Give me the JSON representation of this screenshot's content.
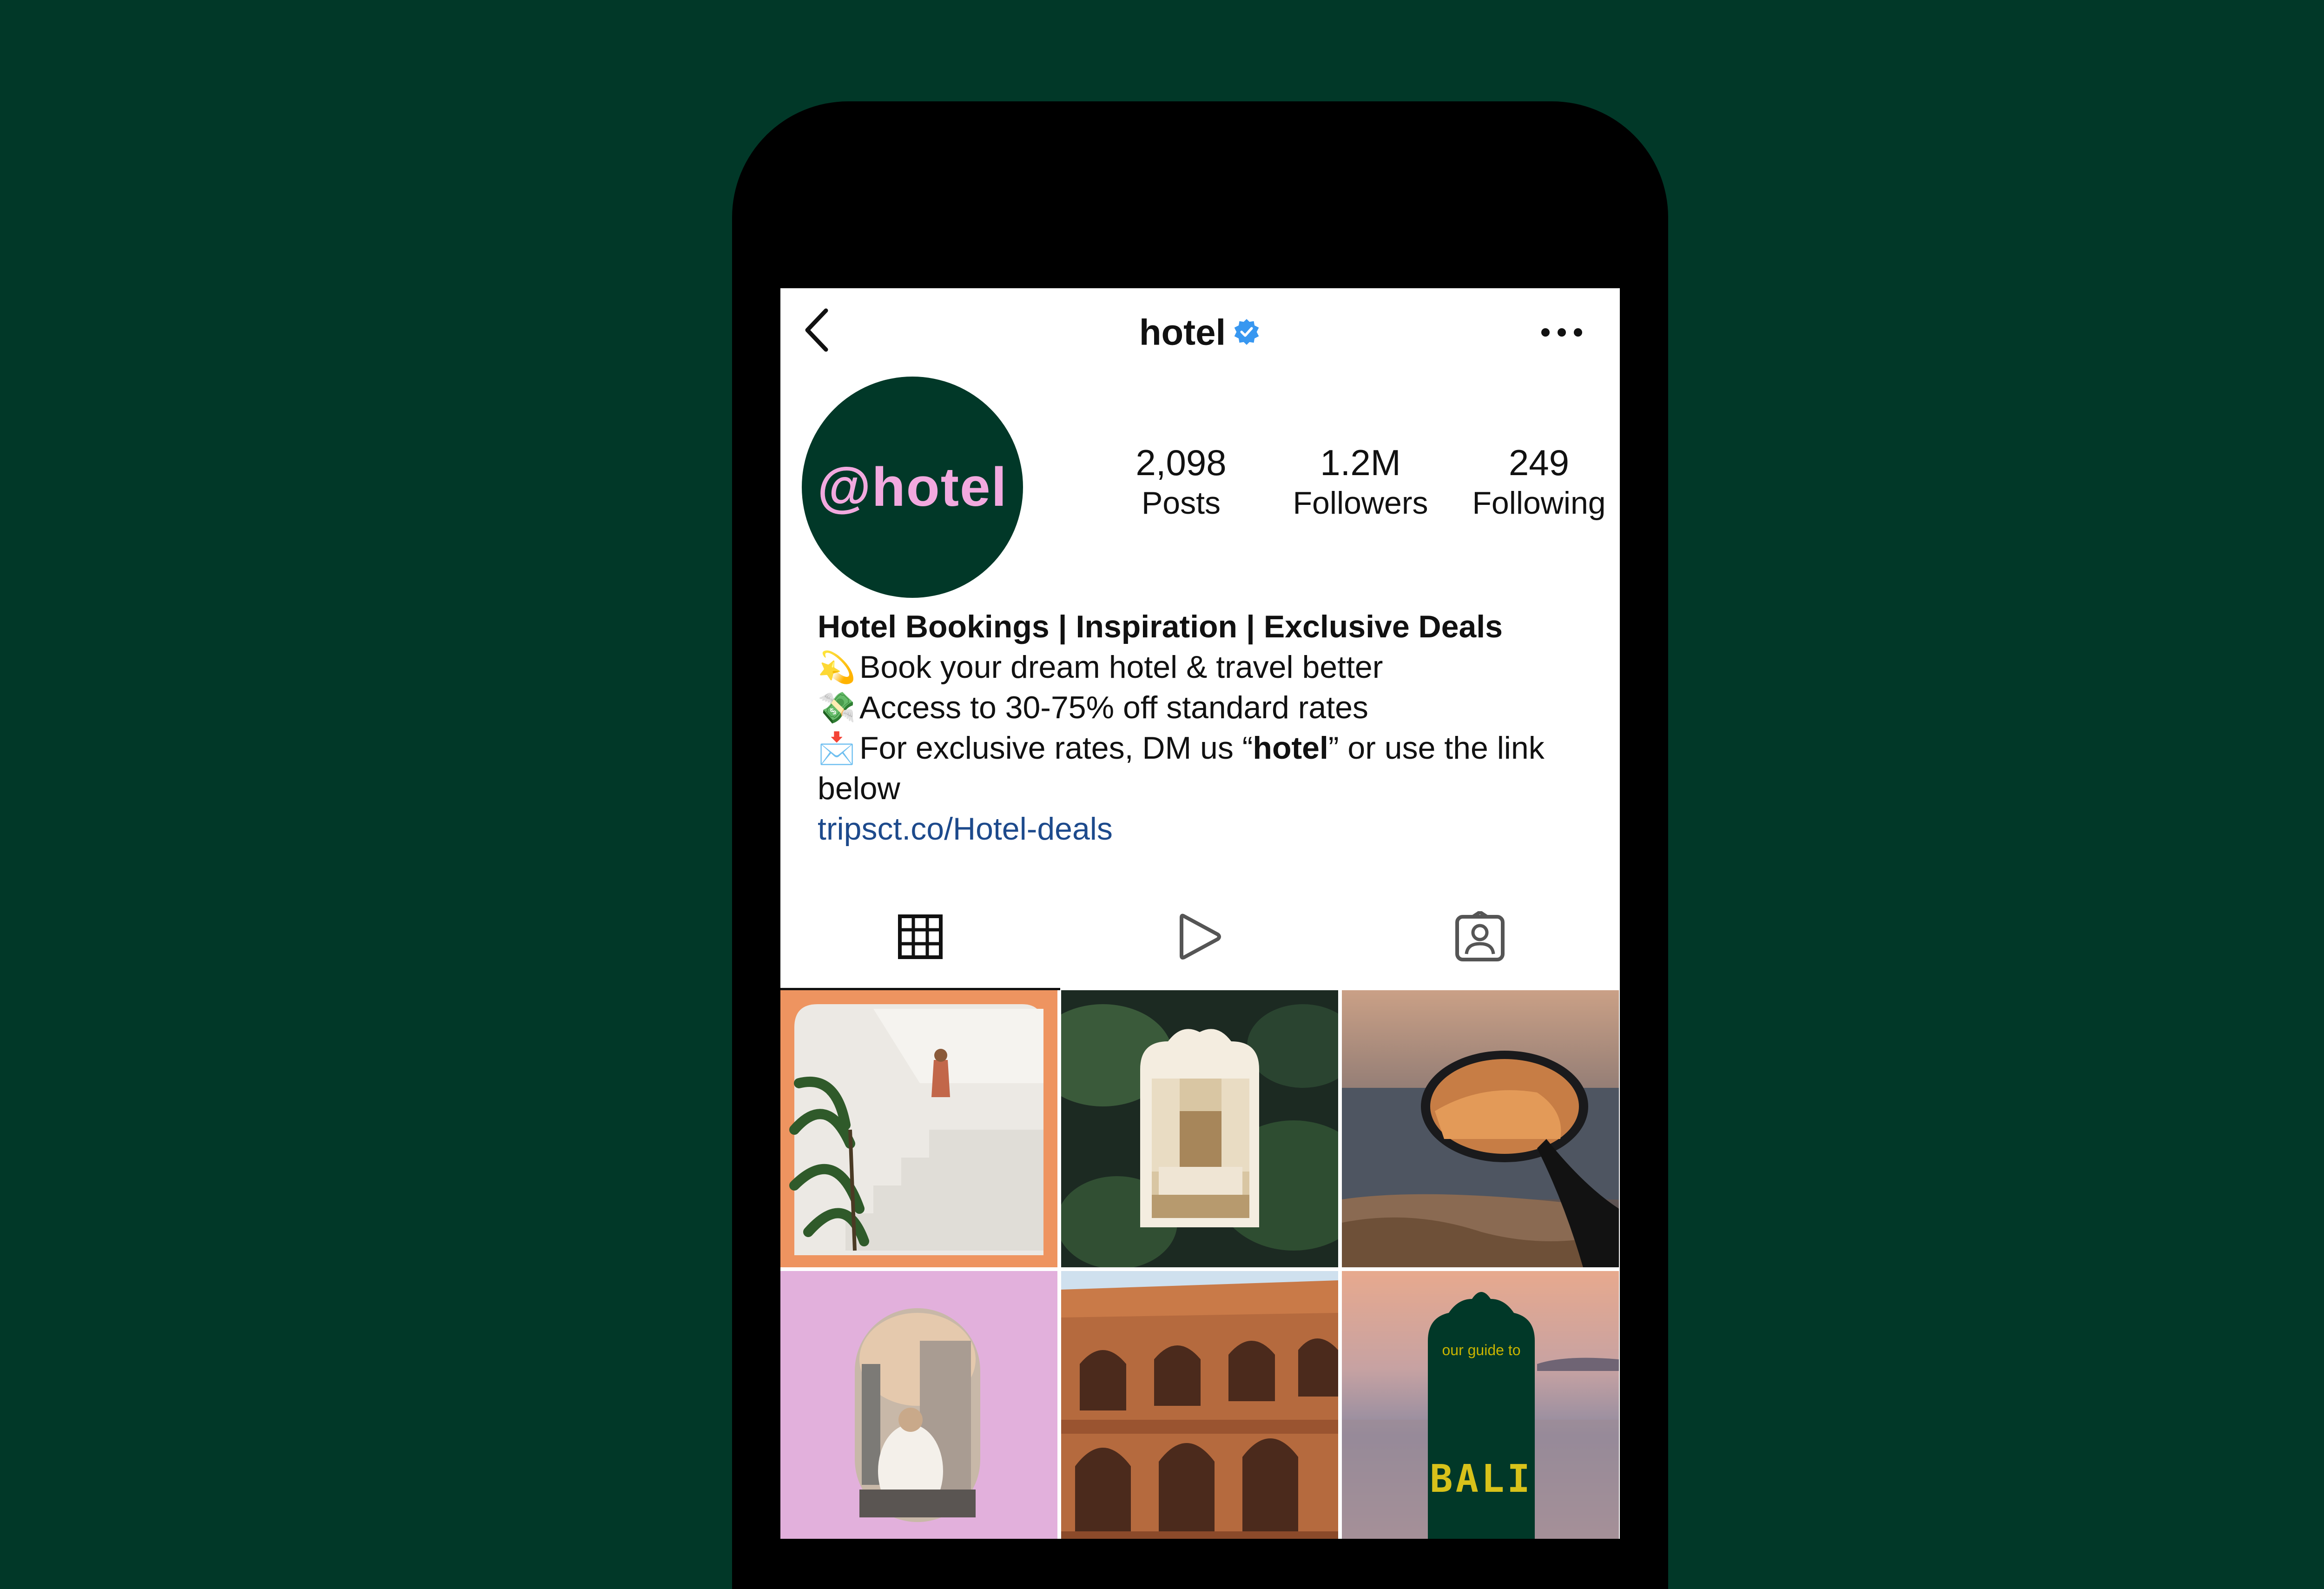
{
  "header": {
    "username": "hotel",
    "back_icon": "chevron-left-icon",
    "verified_icon": "verified-badge-icon",
    "more_icon": "more-horizontal-icon"
  },
  "profile": {
    "avatar_text": "@hotel",
    "stats": [
      {
        "value": "2,098",
        "label": "Posts"
      },
      {
        "value": "1.2M",
        "label": "Followers"
      },
      {
        "value": "249",
        "label": "Following"
      }
    ]
  },
  "bio": {
    "headline": "Hotel Bookings | Inspiration | Exclusive Deals",
    "line1_emoji": "💫",
    "line1": "Book your dream hotel & travel better",
    "line2_emoji": "💸",
    "line2": "Access to 30-75% off standard rates",
    "line3_emoji": "📩",
    "line3_pre": "For exclusive rates, DM us “",
    "line3_bold": "hotel",
    "line3_post": "” or use the link below",
    "link": "tripsct.co/Hotel-deals"
  },
  "tabs": [
    {
      "icon": "grid-icon",
      "active": true
    },
    {
      "icon": "reels-play-icon",
      "active": false
    },
    {
      "icon": "tagged-person-icon",
      "active": false
    }
  ],
  "posts": {
    "bali_small": "our guide to",
    "bali_title": "BALI"
  },
  "colors": {
    "background": "#013828",
    "accent_pink": "#f2a9df",
    "link": "#1d4a8c",
    "verified": "#3897f0"
  }
}
